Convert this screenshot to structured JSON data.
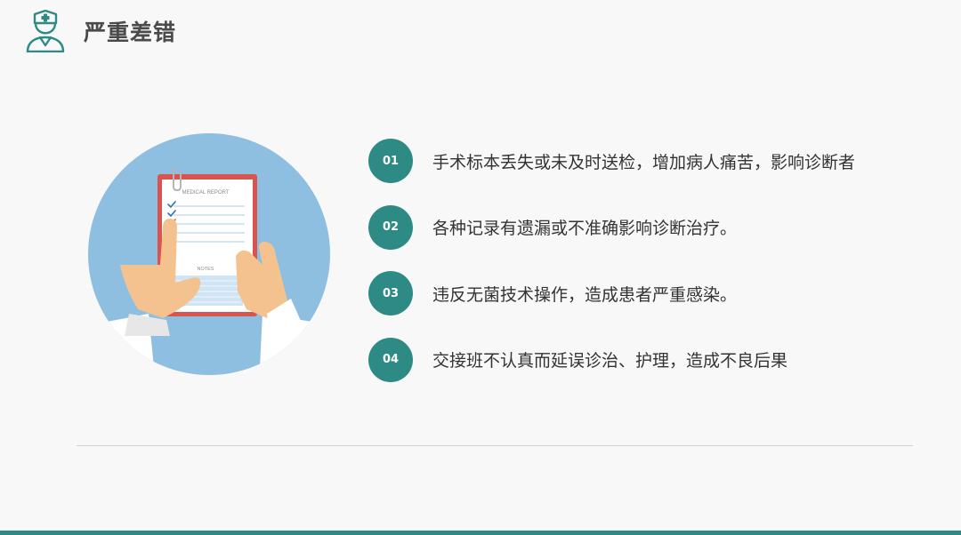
{
  "header": {
    "title": "严重差错",
    "logo_icon": "doctor-icon"
  },
  "illustration": {
    "icon": "medical-report-clipboard-icon",
    "report_title": "MEDICAL REPORT",
    "notes_label": "NOTES"
  },
  "items": [
    {
      "number": "01",
      "text": "手术标本丢失或未及时送检，增加病人痛苦，影响诊断者"
    },
    {
      "number": "02",
      "text": "各种记录有遗漏或不准确影响诊断治疗。"
    },
    {
      "number": "03",
      "text": "违反无菌技术操作，造成患者严重感染。"
    },
    {
      "number": "04",
      "text": "交接班不认真而延误诊治、护理，造成不良后果"
    }
  ],
  "colors": {
    "accent": "#2e8a84",
    "circle": "#8ebfe0",
    "background": "#f8f8f8",
    "clipboard": "#d9534f"
  }
}
